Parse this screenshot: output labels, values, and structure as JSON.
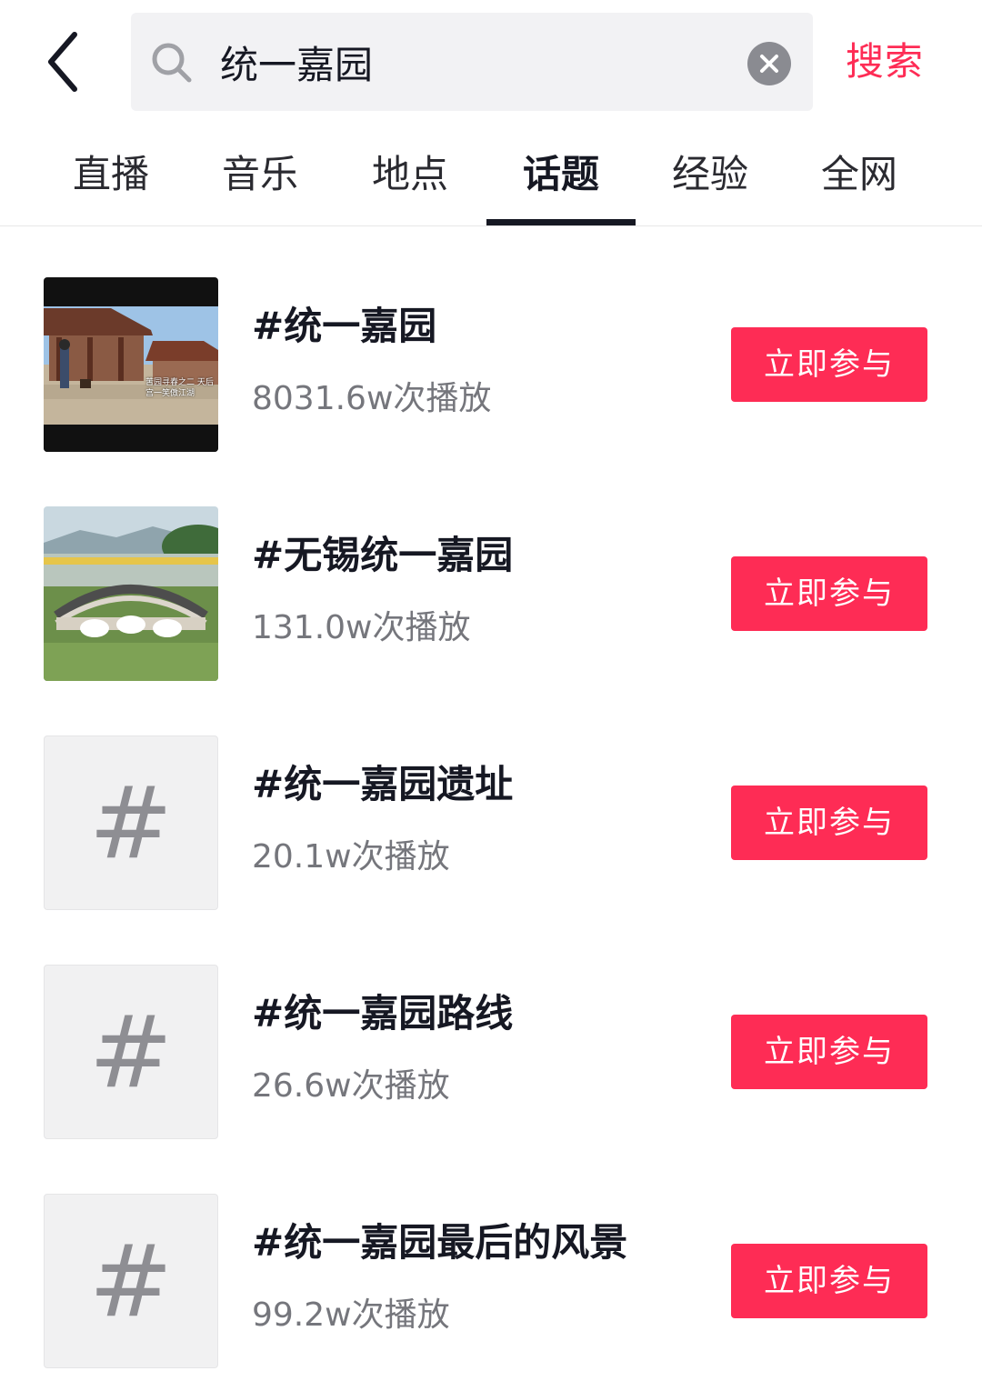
{
  "search": {
    "query": "统一嘉园",
    "submit_label": "搜索"
  },
  "tabs": [
    {
      "label": "直播",
      "active": false
    },
    {
      "label": "音乐",
      "active": false
    },
    {
      "label": "地点",
      "active": false
    },
    {
      "label": "话题",
      "active": true
    },
    {
      "label": "经验",
      "active": false
    },
    {
      "label": "全网",
      "active": false
    }
  ],
  "topics": [
    {
      "title": "#统一嘉园",
      "views": "8031.6w次播放",
      "button": "立即参与",
      "thumb": "video-thumbnail-pavilion",
      "thumb_caption": "苦园寻春之二 天后宫一笑傲江湖"
    },
    {
      "title": "#无锡统一嘉园",
      "views": "131.0w次播放",
      "button": "立即参与",
      "thumb": "video-thumbnail-bridge"
    },
    {
      "title": "#统一嘉园遗址",
      "views": "20.1w次播放",
      "button": "立即参与",
      "thumb": "hash-placeholder",
      "glyph": "#"
    },
    {
      "title": "#统一嘉园路线",
      "views": "26.6w次播放",
      "button": "立即参与",
      "thumb": "hash-placeholder",
      "glyph": "#"
    },
    {
      "title": "#统一嘉园最后的风景",
      "views": "99.2w次播放",
      "button": "立即参与",
      "thumb": "hash-placeholder",
      "glyph": "#"
    }
  ],
  "colors": {
    "accent": "#fe2c55",
    "text_primary": "#161823",
    "text_secondary": "#75767c",
    "search_bg": "#f2f2f4"
  }
}
